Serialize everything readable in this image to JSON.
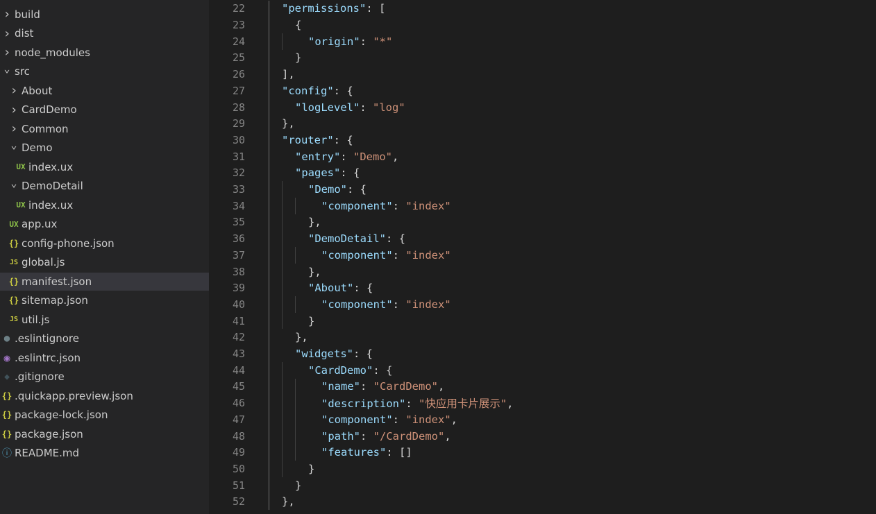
{
  "explorer": {
    "items": [
      {
        "label": "build",
        "icon": "chevron-right-icon",
        "glyph": "›",
        "depth": 0
      },
      {
        "label": "dist",
        "icon": "chevron-right-icon",
        "glyph": "›",
        "depth": 0
      },
      {
        "label": "node_modules",
        "icon": "chevron-right-icon",
        "glyph": "›",
        "depth": 0
      },
      {
        "label": "src",
        "icon": "chevron-down-icon",
        "glyph": "⌄",
        "depth": 0
      },
      {
        "label": "About",
        "icon": "chevron-right-icon",
        "glyph": "›",
        "depth": 1
      },
      {
        "label": "CardDemo",
        "icon": "chevron-right-icon",
        "glyph": "›",
        "depth": 1
      },
      {
        "label": "Common",
        "icon": "chevron-right-icon",
        "glyph": "›",
        "depth": 1
      },
      {
        "label": "Demo",
        "icon": "chevron-down-icon",
        "glyph": "⌄",
        "depth": 1
      },
      {
        "label": "index.ux",
        "icon": "ux-file-icon",
        "glyph": "UX",
        "depth": 2
      },
      {
        "label": "DemoDetail",
        "icon": "chevron-down-icon",
        "glyph": "⌄",
        "depth": 1
      },
      {
        "label": "index.ux",
        "icon": "ux-file-icon",
        "glyph": "UX",
        "depth": 2
      },
      {
        "label": "app.ux",
        "icon": "ux-file-icon",
        "glyph": "UX",
        "depth": 1
      },
      {
        "label": "config-phone.json",
        "icon": "json-file-icon",
        "glyph": "{}",
        "depth": 1
      },
      {
        "label": "global.js",
        "icon": "js-file-icon",
        "glyph": "JS",
        "depth": 1
      },
      {
        "label": "manifest.json",
        "icon": "json-file-icon",
        "glyph": "{}",
        "depth": 1,
        "selected": true
      },
      {
        "label": "sitemap.json",
        "icon": "json-file-icon",
        "glyph": "{}",
        "depth": 1
      },
      {
        "label": "util.js",
        "icon": "js-file-icon",
        "glyph": "JS",
        "depth": 1
      },
      {
        "label": ".eslintignore",
        "icon": "settings-file-icon",
        "glyph": "●",
        "depth": 0
      },
      {
        "label": ".eslintrc.json",
        "icon": "eslint-file-icon",
        "glyph": "◉",
        "depth": 0
      },
      {
        "label": ".gitignore",
        "icon": "git-file-icon",
        "glyph": "◆",
        "depth": 0
      },
      {
        "label": ".quickapp.preview.json",
        "icon": "json-file-icon",
        "glyph": "{}",
        "depth": 0
      },
      {
        "label": "package-lock.json",
        "icon": "json-file-icon",
        "glyph": "{}",
        "depth": 0
      },
      {
        "label": "package.json",
        "icon": "json-file-icon",
        "glyph": "{}",
        "depth": 0
      },
      {
        "label": "README.md",
        "icon": "info-file-icon",
        "glyph": "ⓘ",
        "depth": 0
      }
    ]
  },
  "editor": {
    "file": "manifest.json",
    "lines": [
      {
        "n": "22",
        "indent": 1,
        "tokens": [
          [
            "key",
            "\"permissions\""
          ],
          [
            "punc",
            ": ["
          ]
        ]
      },
      {
        "n": "23",
        "indent": 2,
        "tokens": [
          [
            "punc",
            "{"
          ]
        ]
      },
      {
        "n": "24",
        "indent": 3,
        "tokens": [
          [
            "key",
            "\"origin\""
          ],
          [
            "punc",
            ": "
          ],
          [
            "str",
            "\"*\""
          ]
        ]
      },
      {
        "n": "25",
        "indent": 2,
        "tokens": [
          [
            "punc",
            "}"
          ]
        ]
      },
      {
        "n": "26",
        "indent": 1,
        "tokens": [
          [
            "punc",
            "],"
          ]
        ]
      },
      {
        "n": "27",
        "indent": 1,
        "tokens": [
          [
            "key",
            "\"config\""
          ],
          [
            "punc",
            ": {"
          ]
        ]
      },
      {
        "n": "28",
        "indent": 2,
        "tokens": [
          [
            "key",
            "\"logLevel\""
          ],
          [
            "punc",
            ": "
          ],
          [
            "str",
            "\"log\""
          ]
        ]
      },
      {
        "n": "29",
        "indent": 1,
        "tokens": [
          [
            "punc",
            "},"
          ]
        ]
      },
      {
        "n": "30",
        "indent": 1,
        "tokens": [
          [
            "key",
            "\"router\""
          ],
          [
            "punc",
            ": {"
          ]
        ]
      },
      {
        "n": "31",
        "indent": 2,
        "tokens": [
          [
            "key",
            "\"entry\""
          ],
          [
            "punc",
            ": "
          ],
          [
            "str",
            "\"Demo\""
          ],
          [
            "punc",
            ","
          ]
        ]
      },
      {
        "n": "32",
        "indent": 2,
        "tokens": [
          [
            "key",
            "\"pages\""
          ],
          [
            "punc",
            ": {"
          ]
        ]
      },
      {
        "n": "33",
        "indent": 3,
        "tokens": [
          [
            "key",
            "\"Demo\""
          ],
          [
            "punc",
            ": {"
          ]
        ]
      },
      {
        "n": "34",
        "indent": 4,
        "tokens": [
          [
            "key",
            "\"component\""
          ],
          [
            "punc",
            ": "
          ],
          [
            "str",
            "\"index\""
          ]
        ]
      },
      {
        "n": "35",
        "indent": 3,
        "tokens": [
          [
            "punc",
            "},"
          ]
        ]
      },
      {
        "n": "36",
        "indent": 3,
        "tokens": [
          [
            "key",
            "\"DemoDetail\""
          ],
          [
            "punc",
            ": {"
          ]
        ]
      },
      {
        "n": "37",
        "indent": 4,
        "tokens": [
          [
            "key",
            "\"component\""
          ],
          [
            "punc",
            ": "
          ],
          [
            "str",
            "\"index\""
          ]
        ]
      },
      {
        "n": "38",
        "indent": 3,
        "tokens": [
          [
            "punc",
            "},"
          ]
        ]
      },
      {
        "n": "39",
        "indent": 3,
        "tokens": [
          [
            "key",
            "\"About\""
          ],
          [
            "punc",
            ": {"
          ]
        ]
      },
      {
        "n": "40",
        "indent": 4,
        "tokens": [
          [
            "key",
            "\"component\""
          ],
          [
            "punc",
            ": "
          ],
          [
            "str",
            "\"index\""
          ]
        ]
      },
      {
        "n": "41",
        "indent": 3,
        "tokens": [
          [
            "punc",
            "}"
          ]
        ]
      },
      {
        "n": "42",
        "indent": 2,
        "tokens": [
          [
            "punc",
            "},"
          ]
        ]
      },
      {
        "n": "43",
        "indent": 2,
        "tokens": [
          [
            "key",
            "\"widgets\""
          ],
          [
            "punc",
            ": {"
          ]
        ]
      },
      {
        "n": "44",
        "indent": 3,
        "tokens": [
          [
            "key",
            "\"CardDemo\""
          ],
          [
            "punc",
            ": {"
          ]
        ]
      },
      {
        "n": "45",
        "indent": 4,
        "tokens": [
          [
            "key",
            "\"name\""
          ],
          [
            "punc",
            ": "
          ],
          [
            "str",
            "\"CardDemo\""
          ],
          [
            "punc",
            ","
          ]
        ]
      },
      {
        "n": "46",
        "indent": 4,
        "tokens": [
          [
            "key",
            "\"description\""
          ],
          [
            "punc",
            ": "
          ],
          [
            "str",
            "\"快应用卡片展示\""
          ],
          [
            "punc",
            ","
          ]
        ]
      },
      {
        "n": "47",
        "indent": 4,
        "tokens": [
          [
            "key",
            "\"component\""
          ],
          [
            "punc",
            ": "
          ],
          [
            "str",
            "\"index\""
          ],
          [
            "punc",
            ","
          ]
        ]
      },
      {
        "n": "48",
        "indent": 4,
        "tokens": [
          [
            "key",
            "\"path\""
          ],
          [
            "punc",
            ": "
          ],
          [
            "str",
            "\"/CardDemo\""
          ],
          [
            "punc",
            ","
          ]
        ]
      },
      {
        "n": "49",
        "indent": 4,
        "tokens": [
          [
            "key",
            "\"features\""
          ],
          [
            "punc",
            ": []"
          ]
        ]
      },
      {
        "n": "50",
        "indent": 3,
        "tokens": [
          [
            "punc",
            "}"
          ]
        ]
      },
      {
        "n": "51",
        "indent": 2,
        "tokens": [
          [
            "punc",
            "}"
          ]
        ]
      },
      {
        "n": "52",
        "indent": 1,
        "tokens": [
          [
            "punc",
            "},"
          ]
        ]
      }
    ]
  },
  "colors": {
    "key": "#9cdcfe",
    "string": "#ce9178",
    "punctuation": "#d4d4d4",
    "line_number": "#858585",
    "sidebar_bg": "#252526",
    "selected_bg": "#37373d",
    "editor_bg": "#1e1e1e"
  }
}
